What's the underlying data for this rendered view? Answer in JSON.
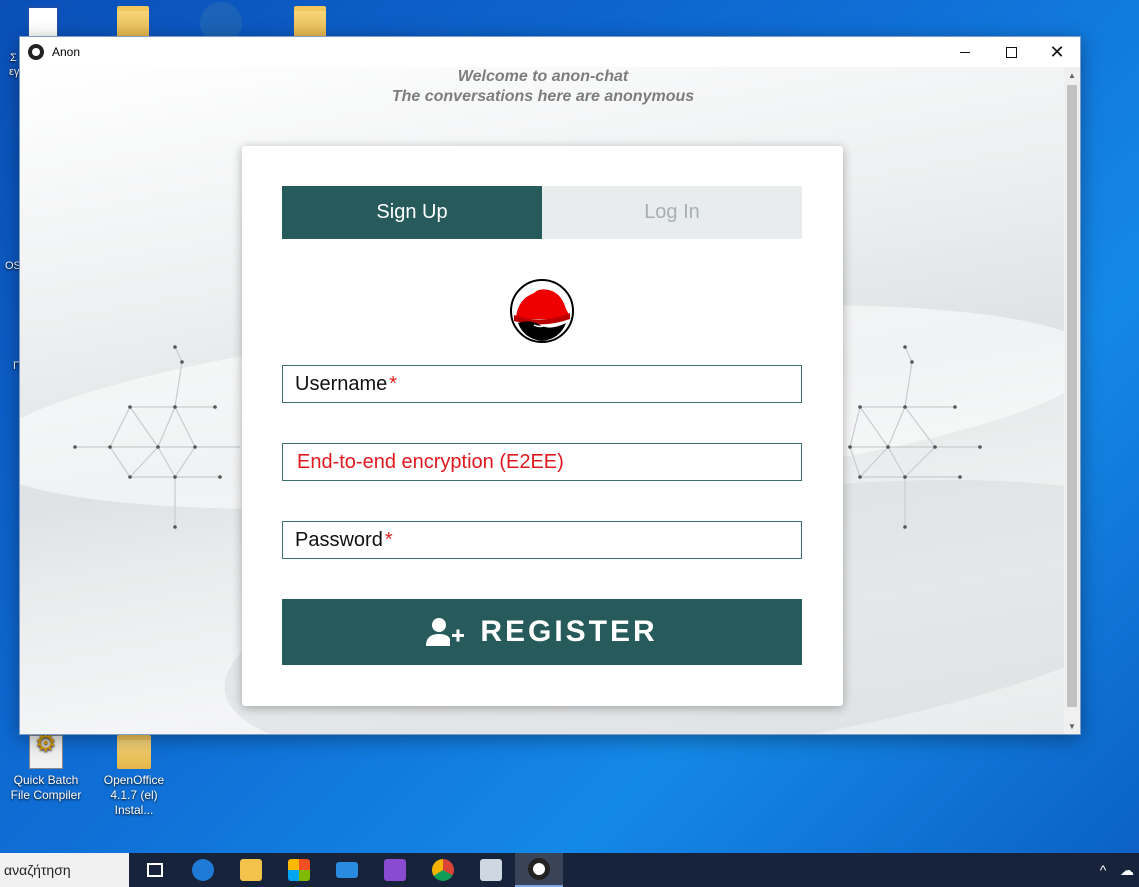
{
  "desktop": {
    "icons": [
      {
        "label": "Quick Batch File Compiler"
      },
      {
        "label": "OpenOffice 4.1.7 (el) Instal..."
      }
    ],
    "edge_fragments": [
      "Σ",
      "εγ",
      "OS",
      "Π"
    ]
  },
  "window": {
    "title": "Anon",
    "controls": {
      "minimize": "minimize",
      "maximize": "maximize",
      "close": "✕"
    }
  },
  "app": {
    "welcome_line1": "Welcome to anon-chat",
    "welcome_line2": "The conversations here are anonymous",
    "tabs": [
      {
        "label": "Sign Up",
        "active": true
      },
      {
        "label": "Log In",
        "active": false
      }
    ],
    "logo": "redhat-logo",
    "fields": {
      "username": {
        "label": "Username",
        "required_mark": "*"
      },
      "e2ee": {
        "label": "End-to-end encryption (E2EE)"
      },
      "password": {
        "label": "Password",
        "required_mark": "*"
      }
    },
    "register_button": {
      "label": "REGISTER",
      "icon": "add-user-icon"
    }
  },
  "taskbar": {
    "search_placeholder": "αναζήτηση",
    "apps": [
      "task-view-icon",
      "edge-icon",
      "file-explorer-icon",
      "store-icon",
      "mail-icon",
      "visual-studio-icon",
      "chrome-icon",
      "photos-icon",
      "anon-app-icon"
    ],
    "tray": {
      "chevron": "^",
      "cloud": "☁"
    }
  },
  "colors": {
    "accent": "#275b5b",
    "required": "#e02020",
    "inactive_tab": "#e9ecec",
    "desktop": "#0f6fd6",
    "taskbar": "#17233a"
  }
}
